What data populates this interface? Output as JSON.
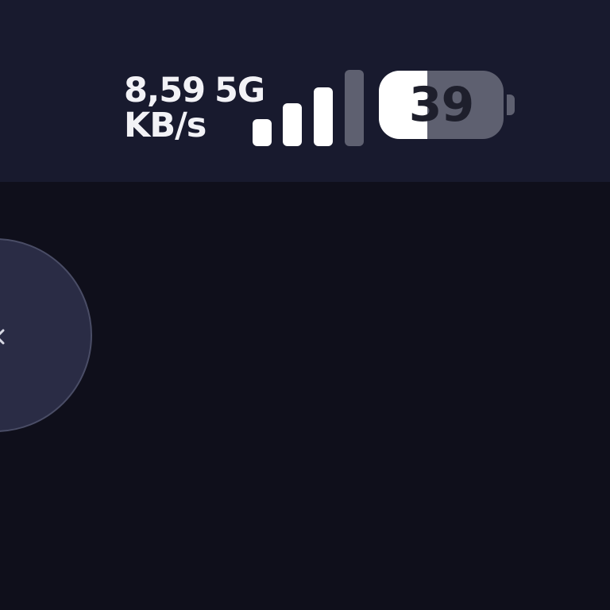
{
  "status_bar": {
    "net_speed_value": "8,59",
    "net_speed_unit": "KB/s",
    "network_type": "5G",
    "signal": {
      "icon": "signal-strength-icon",
      "bars_total": 4,
      "bars_active": 3
    },
    "battery": {
      "icon": "battery-icon",
      "level_text": "39",
      "level_fraction": 0.39
    }
  },
  "main": {
    "floating_button_icon": "chevron-left-icon"
  },
  "colors": {
    "status_bar_bg": "#181a2e",
    "page_bg": "#0f0f1b",
    "text": "#f2f2f6",
    "inactive": "#5e6070",
    "button_bg": "#2a2c45"
  }
}
